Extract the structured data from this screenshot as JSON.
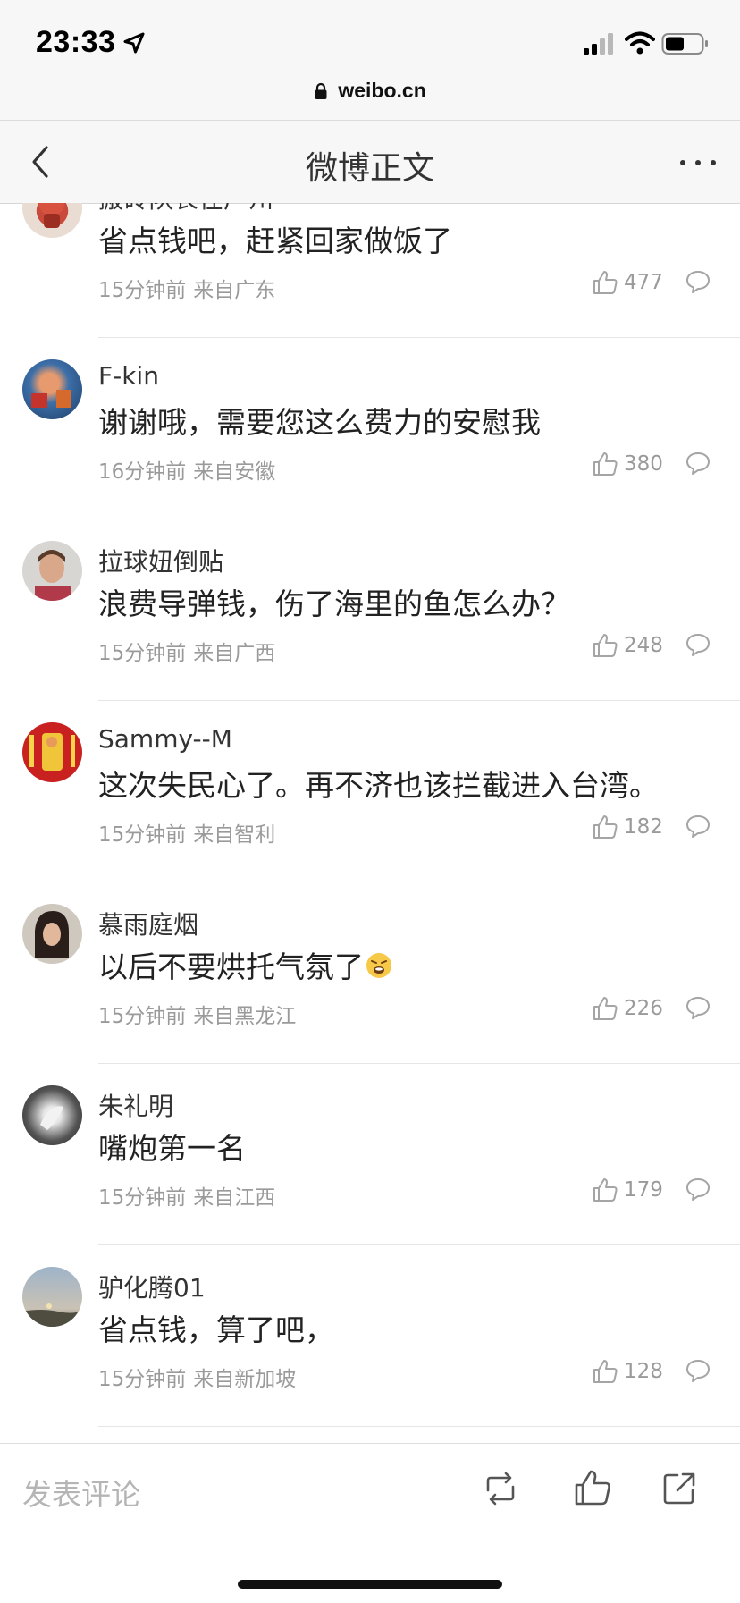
{
  "status_bar": {
    "time": "23:33",
    "icons": [
      "location-arrow-icon",
      "signal-icon",
      "wifi-icon",
      "battery-icon"
    ]
  },
  "url_bar": {
    "url": "weibo.cn"
  },
  "nav": {
    "title": "微博正文"
  },
  "comments": [
    {
      "name": "搬砖队长在广州",
      "text": "省点钱吧，赶紧回家做饭了",
      "time": "15分钟前",
      "source": "来自广东",
      "likes": "477"
    },
    {
      "name": "F-kin",
      "text": "谢谢哦，需要您这么费力的安慰我",
      "time": "16分钟前",
      "source": "来自安徽",
      "likes": "380"
    },
    {
      "name": "拉球妞倒贴",
      "text": "浪费导弹钱，伤了海里的鱼怎么办？",
      "time": "15分钟前",
      "source": "来自广西",
      "likes": "248"
    },
    {
      "name": "Sammy--M",
      "text": "这次失民心了。再不济也该拦截进入台湾。",
      "time": "15分钟前",
      "source": "来自智利",
      "likes": "182"
    },
    {
      "name": "慕雨庭烟",
      "text": "以后不要烘托气氛了",
      "time": "15分钟前",
      "source": "来自黑龙江",
      "likes": "226"
    },
    {
      "name": "朱礼明",
      "text": "嘴炮第一名",
      "time": "15分钟前",
      "source": "来自江西",
      "likes": "179"
    },
    {
      "name": "驴化腾01",
      "text": "省点钱，算了吧，",
      "time": "15分钟前",
      "source": "来自新加坡",
      "likes": "128"
    }
  ],
  "bottom_bar": {
    "comment_placeholder": "发表评论"
  },
  "colors": {
    "accent_gray": "#9a9a9a",
    "bar_bg": "#f7f7f7",
    "divider": "#e6e6e6"
  }
}
